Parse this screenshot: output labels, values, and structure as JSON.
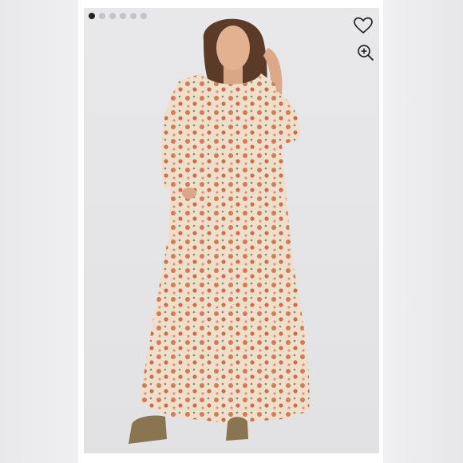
{
  "gallery": {
    "image_count": 6,
    "active_index": 0
  },
  "actions": {
    "favorite_icon": "heart-icon",
    "zoom_icon": "zoom-in-icon"
  },
  "colors": {
    "dress_base": "#efdfca",
    "floral_print": "#cf7c5d",
    "boots": "#8a7551",
    "background": "#e6e6e8"
  }
}
